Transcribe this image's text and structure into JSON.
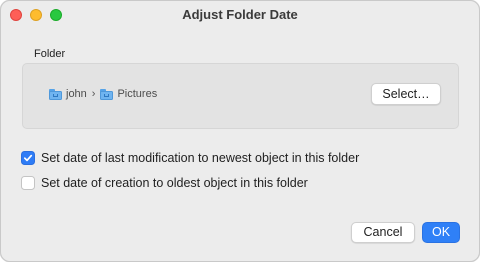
{
  "window": {
    "title": "Adjust Folder Date"
  },
  "folder": {
    "group_label": "Folder",
    "path": [
      {
        "label": "john",
        "icon": "folder-icon"
      },
      {
        "label": "Pictures",
        "icon": "folder-icon"
      }
    ],
    "separator": "›",
    "select_label": "Select…"
  },
  "options": [
    {
      "label": "Set date of last modification to newest object in this folder",
      "checked": true
    },
    {
      "label": "Set date of creation to oldest object in this folder",
      "checked": false
    }
  ],
  "buttons": {
    "cancel_label": "Cancel",
    "ok_label": "OK"
  },
  "colors": {
    "accent": "#2f80f7",
    "close": "#fe5f57",
    "minimize": "#febc2e",
    "maximize": "#28c840",
    "folder": "#6fb4f0"
  }
}
